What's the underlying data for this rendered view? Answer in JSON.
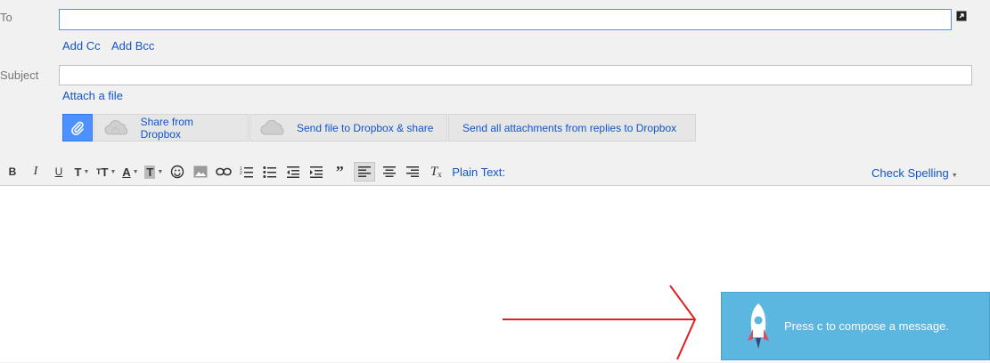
{
  "compose": {
    "to_label": "To",
    "to_value": "",
    "add_cc": "Add Cc",
    "add_bcc": "Add Bcc",
    "subject_label": "Subject",
    "subject_value": "",
    "attach_file": "Attach a file"
  },
  "dropbox": {
    "share": "Share from Dropbox",
    "send_file": "Send file to Dropbox & share",
    "send_all": "Send all attachments from replies to Dropbox"
  },
  "format_toolbar": {
    "plain_text": "Plain Text:",
    "check_spelling": "Check Spelling"
  },
  "toast": {
    "message": "Press c to compose a message."
  },
  "colors": {
    "link": "#1155cc",
    "toast_bg": "#5bb6e0",
    "annotation_arrow": "#e02020"
  }
}
